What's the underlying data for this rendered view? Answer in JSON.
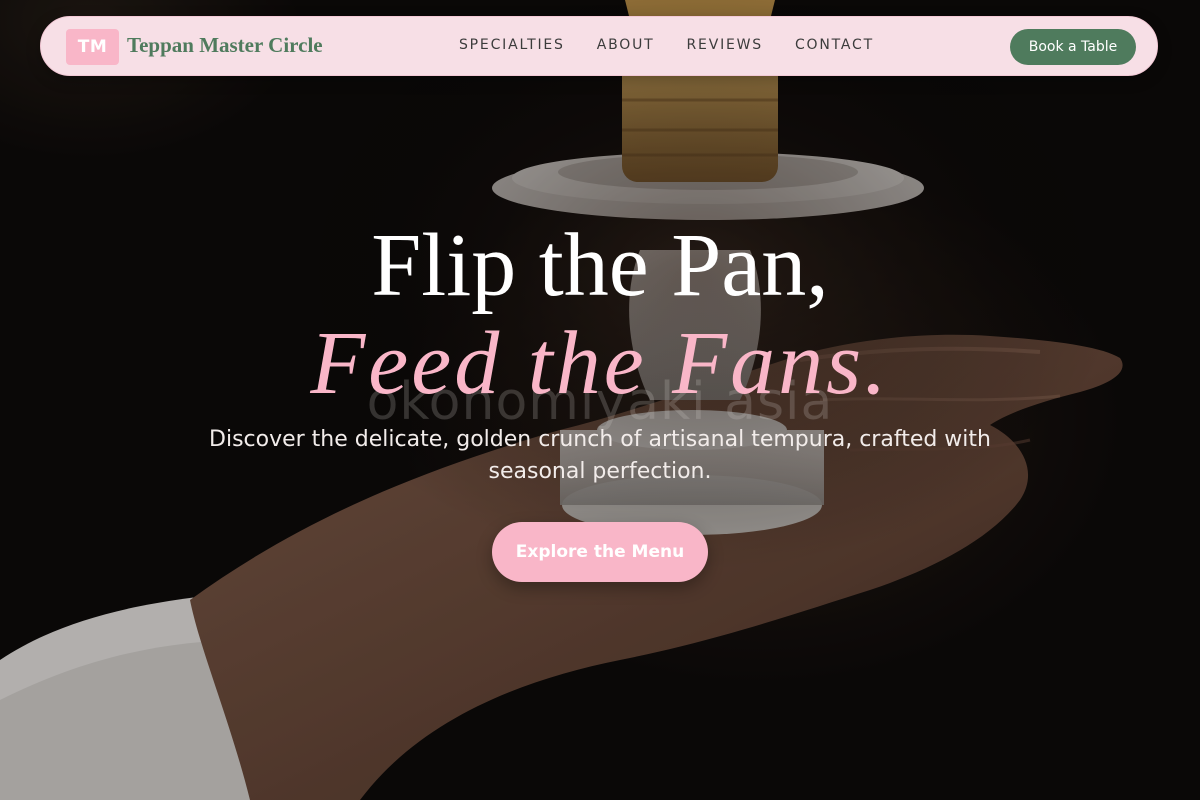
{
  "brand": {
    "badge": "TM",
    "name": "Teppan Master Circle"
  },
  "nav": {
    "links": [
      "SPECIALTIES",
      "ABOUT",
      "REVIEWS",
      "CONTACT"
    ],
    "book_label": "Book a Table"
  },
  "hero": {
    "title_line1": "Flip the Pan,",
    "title_line2": "Feed the Fans.",
    "watermark": "okonomiyaki asia",
    "subtitle": "Discover the delicate, golden crunch of artisanal tempura, crafted with seasonal perfection.",
    "cta_label": "Explore the Menu"
  },
  "colors": {
    "accent_pink": "#f9b6c8",
    "accent_green": "#4f7b5d",
    "nav_background": "#f7dfe6"
  }
}
